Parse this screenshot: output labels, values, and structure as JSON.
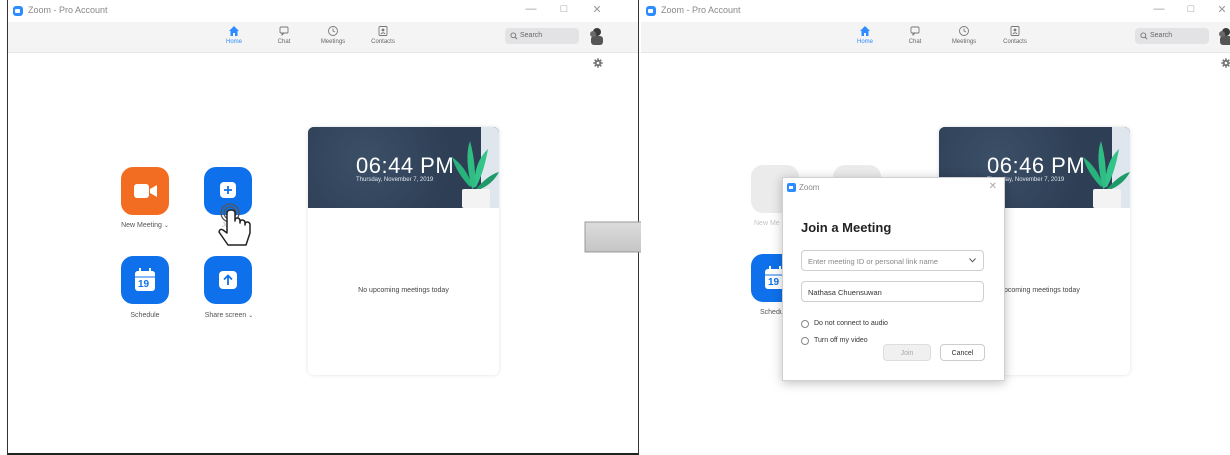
{
  "left": {
    "title": "Zoom - Pro Account",
    "nav": [
      {
        "label": "Home",
        "icon": "home-icon"
      },
      {
        "label": "Chat",
        "icon": "chat-icon"
      },
      {
        "label": "Meetings",
        "icon": "clock-icon"
      },
      {
        "label": "Contacts",
        "icon": "contacts-icon"
      }
    ],
    "search_placeholder": "Search",
    "actions": {
      "new_meeting": "New Meeting",
      "join": "Join",
      "schedule": "Schedule",
      "share_screen": "Share screen",
      "calendar_day": "19"
    },
    "card": {
      "time": "06:44 PM",
      "date": "Thursday, November 7, 2019",
      "empty": "No upcoming meetings today"
    }
  },
  "right": {
    "title": "Zoom - Pro Account",
    "nav": [
      {
        "label": "Home",
        "icon": "home-icon"
      },
      {
        "label": "Chat",
        "icon": "chat-icon"
      },
      {
        "label": "Meetings",
        "icon": "clock-icon"
      },
      {
        "label": "Contacts",
        "icon": "contacts-icon"
      }
    ],
    "search_placeholder": "Search",
    "card": {
      "time": "06:46 PM",
      "date": "Thursday, November 7, 2019",
      "empty": "No upcoming meetings today"
    },
    "partial": {
      "new_meeting": "New Me",
      "schedule": "Schedu",
      "calendar_day": "19"
    },
    "dialog": {
      "window_title": "Zoom",
      "heading": "Join a Meeting",
      "meeting_id_placeholder": "Enter meeting ID or personal link name",
      "name_value": "Nathasa Chuensuwan",
      "opt_audio": "Do not connect to audio",
      "opt_video": "Turn off my video",
      "join_label": "Join",
      "cancel_label": "Cancel"
    }
  },
  "colors": {
    "accent": "#0e71eb",
    "new_meeting": "#f26d21",
    "hero": "#2e3f55"
  }
}
